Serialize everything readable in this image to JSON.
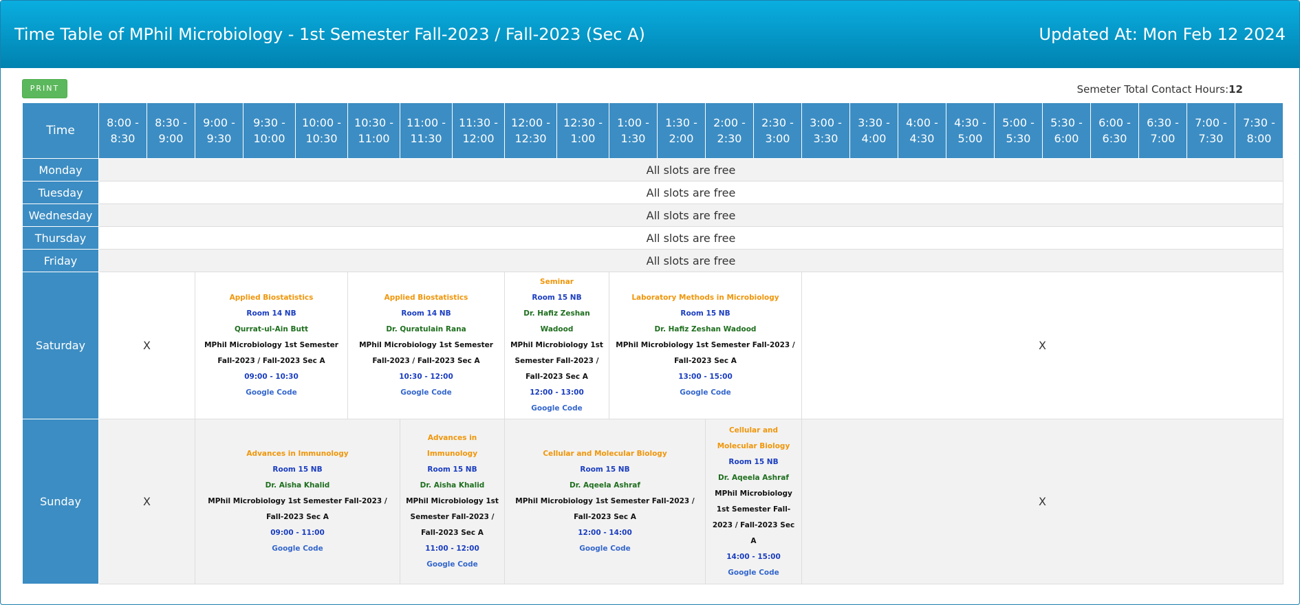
{
  "header": {
    "title": "Time Table of MPhil Microbiology - 1st Semester Fall-2023 / Fall-2023 (Sec A)",
    "updated": "Updated At: Mon Feb 12 2024"
  },
  "toolbar": {
    "print_label": "PRINT",
    "contact_label": "Semeter Total Contact Hours:",
    "contact_value": "12"
  },
  "table": {
    "time_header": "Time",
    "slots": [
      "8:00 - 8:30",
      "8:30 - 9:00",
      "9:00 - 9:30",
      "9:30 - 10:00",
      "10:00 - 10:30",
      "10:30 - 11:00",
      "11:00 - 11:30",
      "11:30 - 12:00",
      "12:00 - 12:30",
      "12:30 - 1:00",
      "1:00 - 1:30",
      "1:30 - 2:00",
      "2:00 - 2:30",
      "2:30 - 3:00",
      "3:00 - 3:30",
      "3:30 - 4:00",
      "4:00 - 4:30",
      "4:30 - 5:00",
      "5:00 - 5:30",
      "5:30 - 6:00",
      "6:00 - 6:30",
      "6:30 - 7:00",
      "7:00 - 7:30",
      "7:30 - 8:00"
    ],
    "free_days": [
      {
        "day": "Monday",
        "message": "All slots are free"
      },
      {
        "day": "Tuesday",
        "message": "All slots are free"
      },
      {
        "day": "Wednesday",
        "message": "All slots are free"
      },
      {
        "day": "Thursday",
        "message": "All slots are free"
      },
      {
        "day": "Friday",
        "message": "All slots are free"
      }
    ],
    "saturday": {
      "day": "Saturday",
      "empty_before": "X",
      "empty_after": "X",
      "classes": [
        {
          "course": "Applied Biostatistics",
          "room": "Room 14 NB",
          "teacher": "Qurrat-ul-Ain Butt",
          "group": "MPhil Microbiology 1st Semester Fall-2023 / Fall-2023 Sec A",
          "time": "09:00 - 10:30",
          "link": "Google Code"
        },
        {
          "course": "Applied Biostatistics",
          "room": "Room 14 NB",
          "teacher": "Dr. Quratulain Rana",
          "group": "MPhil Microbiology 1st Semester Fall-2023 / Fall-2023 Sec A",
          "time": "10:30 - 12:00",
          "link": "Google Code"
        },
        {
          "course": "Seminar",
          "room": "Room 15 NB",
          "teacher": "Dr. Hafiz Zeshan Wadood",
          "group": "MPhil Microbiology 1st Semester Fall-2023 / Fall-2023 Sec A",
          "time": "12:00 - 13:00",
          "link": "Google Code"
        },
        {
          "course": "Laboratory Methods in Microbiology",
          "room": "Room 15 NB",
          "teacher": "Dr. Hafiz Zeshan Wadood",
          "group": "MPhil Microbiology 1st Semester Fall-2023 / Fall-2023 Sec A",
          "time": "13:00 - 15:00",
          "link": "Google Code"
        }
      ]
    },
    "sunday": {
      "day": "Sunday",
      "empty_before": "X",
      "empty_after": "X",
      "classes": [
        {
          "course": "Advances in Immunology",
          "room": "Room 15 NB",
          "teacher": "Dr. Aisha Khalid",
          "group": "MPhil Microbiology 1st Semester Fall-2023 / Fall-2023 Sec A",
          "time": "09:00 - 11:00",
          "link": "Google Code"
        },
        {
          "course": "Advances in Immunology",
          "room": "Room 15 NB",
          "teacher": "Dr. Aisha Khalid",
          "group": "MPhil Microbiology 1st Semester Fall-2023 / Fall-2023 Sec A",
          "time": "11:00 - 12:00",
          "link": "Google Code"
        },
        {
          "course": "Cellular and Molecular Biology",
          "room": "Room 15 NB",
          "teacher": "Dr. Aqeela Ashraf",
          "group": "MPhil Microbiology 1st Semester Fall-2023 / Fall-2023 Sec A",
          "time": "12:00 - 14:00",
          "link": "Google Code"
        },
        {
          "course": "Cellular and Molecular Biology",
          "room": "Room 15 NB",
          "teacher": "Dr. Aqeela Ashraf",
          "group": "MPhil Microbiology 1st Semester Fall-2023 / Fall-2023 Sec A",
          "time": "14:00 - 15:00",
          "link": "Google Code"
        }
      ]
    }
  }
}
